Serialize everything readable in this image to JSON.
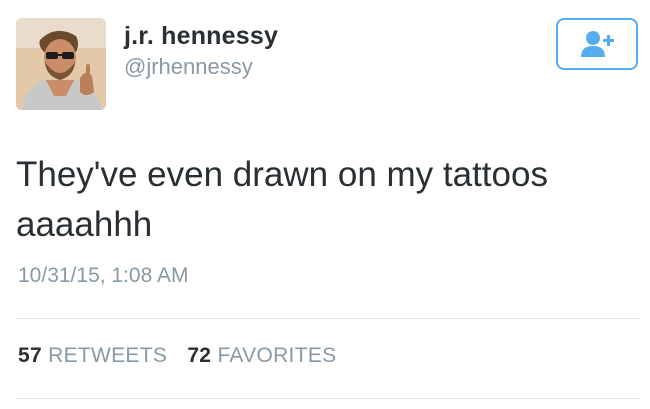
{
  "user": {
    "display_name": "j.r. hennessy",
    "handle": "@jrhennessy",
    "avatar_icon": "profile-photo"
  },
  "follow_button": {
    "icon": "add-user-icon",
    "color": "#55acee"
  },
  "tweet": {
    "text": "They've even drawn on my tattoos aaaahhh",
    "timestamp": "10/31/15, 1:08 AM"
  },
  "stats": {
    "retweets_count": "57",
    "retweets_label": "RETWEETS",
    "favorites_count": "72",
    "favorites_label": "FAVORITES"
  },
  "colors": {
    "text_primary": "#292f33",
    "text_secondary": "#8899a6",
    "accent": "#55acee",
    "divider": "#e1e8ed"
  }
}
